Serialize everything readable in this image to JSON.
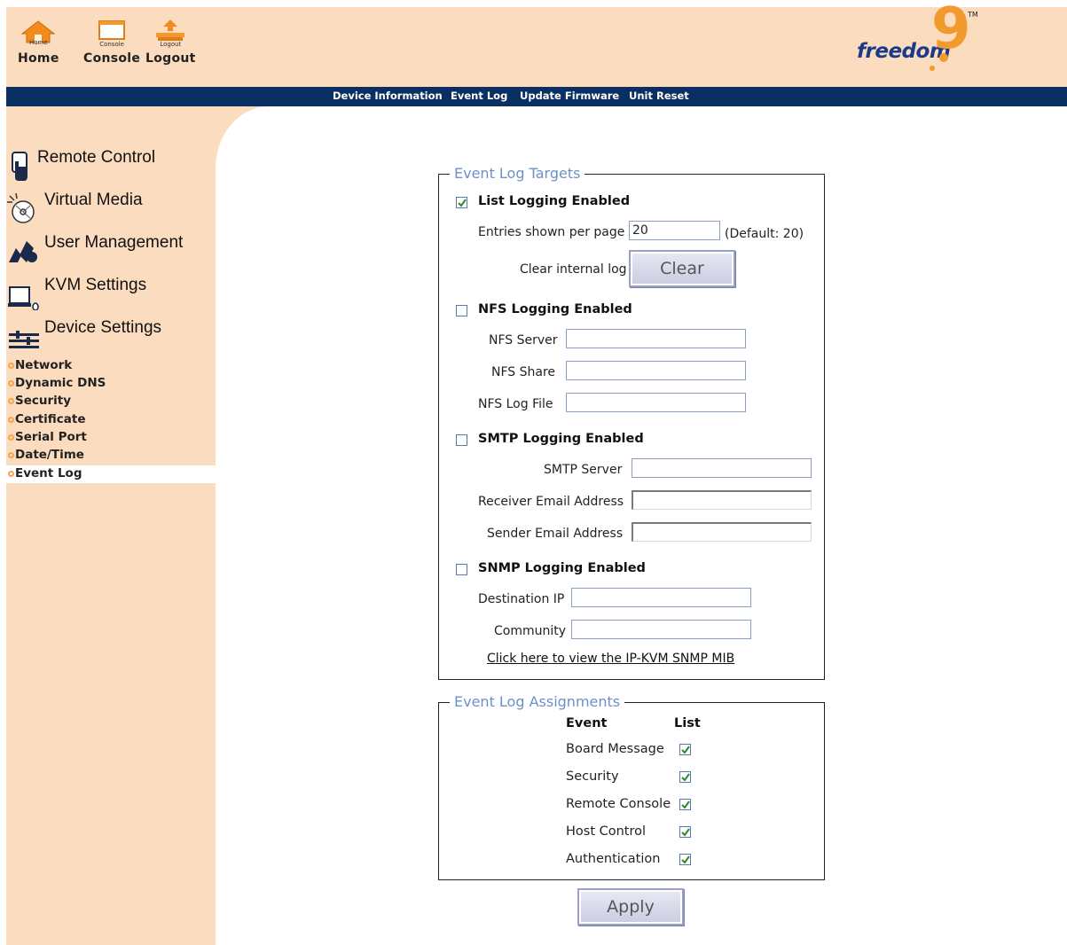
{
  "toolbar": {
    "home": {
      "small": "Home",
      "label": "Home"
    },
    "console": {
      "small": "Console",
      "label": "Console"
    },
    "logout": {
      "small": "Logout",
      "label": "Logout"
    }
  },
  "brand": {
    "name": "freedom",
    "mark": "9",
    "tm": "TM"
  },
  "nav": [
    "Device Information",
    "Event Log",
    "Update Firmware",
    "Unit Reset"
  ],
  "sidebar": {
    "items": [
      {
        "label": "Remote Control",
        "icon": "hand-pointer-icon"
      },
      {
        "label": "Virtual Media",
        "icon": "cd-disc-icon"
      },
      {
        "label": "User Management",
        "icon": "users-icon"
      },
      {
        "label": "KVM Settings",
        "icon": "computer-icon"
      },
      {
        "label": "Device Settings",
        "icon": "settings-bars-icon"
      }
    ],
    "sub_items": [
      "Network",
      "Dynamic DNS",
      "Security",
      "Certificate",
      "Serial Port",
      "Date/Time",
      "Event Log"
    ],
    "selected": "Event Log"
  },
  "targets": {
    "legend": "Event Log Targets",
    "list": {
      "label": "List Logging Enabled",
      "checked": true,
      "entries_label": "Entries shown per page",
      "entries_value": "20",
      "default_note": "(Default: 20)",
      "clear_label": "Clear internal log",
      "clear_button": "Clear"
    },
    "nfs": {
      "label": "NFS Logging Enabled",
      "checked": false,
      "server_label": "NFS Server",
      "share_label": "NFS Share",
      "logfile_label": "NFS Log File"
    },
    "smtp": {
      "label": "SMTP Logging Enabled",
      "checked": false,
      "server_label": "SMTP Server",
      "receiver_label": "Receiver Email Address",
      "sender_label": "Sender Email Address"
    },
    "snmp": {
      "label": "SNMP Logging Enabled",
      "checked": false,
      "dest_label": "Destination IP",
      "community_label": "Community",
      "mib_link": "Click here to view the IP-KVM SNMP MIB"
    }
  },
  "assignments": {
    "legend": "Event Log Assignments",
    "col_event": "Event",
    "col_list": "List",
    "rows": [
      {
        "event": "Board Message",
        "list": true
      },
      {
        "event": "Security",
        "list": true
      },
      {
        "event": "Remote Console",
        "list": true
      },
      {
        "event": "Host Control",
        "list": true
      },
      {
        "event": "Authentication",
        "list": true
      }
    ]
  },
  "apply_button": "Apply",
  "colors": {
    "header_bg": "#fbdcbf",
    "navbar_bg": "#0a2f62",
    "legend_text": "#6c90c8",
    "brand_blue": "#1a3a8a",
    "brand_orange": "#f39a2e"
  }
}
